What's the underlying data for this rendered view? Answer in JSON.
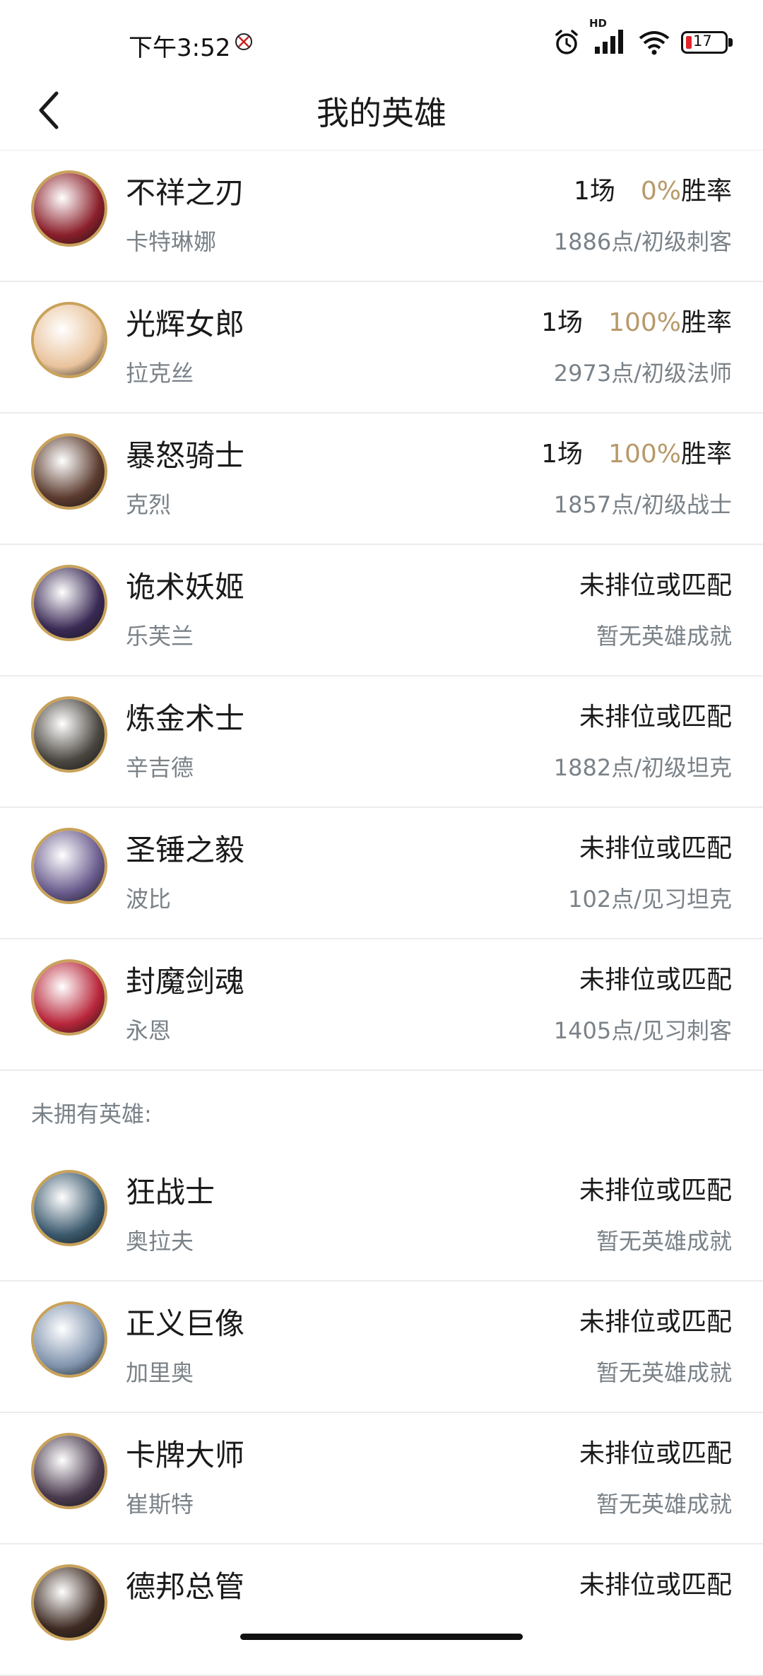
{
  "status_bar": {
    "time": "下午3:52",
    "battery": "17",
    "network_badge": "HD"
  },
  "header": {
    "title": "我的英雄"
  },
  "colors": {
    "accent_gold": "#b8996a",
    "avatar_ring": "#c9a25a",
    "battery_low": "#e0262b"
  },
  "owned_heroes": [
    {
      "title": "不祥之刃",
      "name": "卡特琳娜",
      "games": "1场",
      "win_rate": "0%",
      "win_label": "胜率",
      "detail": "1886点/初级刺客",
      "avatar_color": "#8a1f2a"
    },
    {
      "title": "光辉女郎",
      "name": "拉克丝",
      "games": "1场",
      "win_rate": "100%",
      "win_label": "胜率",
      "detail": "2973点/初级法师",
      "avatar_color": "#e9c39c"
    },
    {
      "title": "暴怒骑士",
      "name": "克烈",
      "games": "1场",
      "win_rate": "100%",
      "win_label": "胜率",
      "detail": "1857点/初级战士",
      "avatar_color": "#5b3b2e"
    },
    {
      "title": "诡术妖姬",
      "name": "乐芙兰",
      "status": "未排位或匹配",
      "detail": "暂无英雄成就",
      "avatar_color": "#3a2a55"
    },
    {
      "title": "炼金术士",
      "name": "辛吉德",
      "status": "未排位或匹配",
      "detail": "1882点/初级坦克",
      "avatar_color": "#4a4640"
    },
    {
      "title": "圣锤之毅",
      "name": "波比",
      "status": "未排位或匹配",
      "detail": "102点/见习坦克",
      "avatar_color": "#6a5c8e"
    },
    {
      "title": "封魔剑魂",
      "name": "永恩",
      "status": "未排位或匹配",
      "detail": "1405点/见习刺客",
      "avatar_color": "#b8263a"
    }
  ],
  "unowned_section_label": "未拥有英雄:",
  "unowned_heroes": [
    {
      "title": "狂战士",
      "name": "奥拉夫",
      "status": "未排位或匹配",
      "detail": "暂无英雄成就",
      "avatar_color": "#3c5a6e"
    },
    {
      "title": "正义巨像",
      "name": "加里奥",
      "status": "未排位或匹配",
      "detail": "暂无英雄成就",
      "avatar_color": "#7f93ad"
    },
    {
      "title": "卡牌大师",
      "name": "崔斯特",
      "status": "未排位或匹配",
      "detail": "暂无英雄成就",
      "avatar_color": "#4a3a4e"
    },
    {
      "title": "德邦总管",
      "name": "",
      "status": "未排位或匹配",
      "detail": "",
      "avatar_color": "#3d2a22"
    }
  ]
}
